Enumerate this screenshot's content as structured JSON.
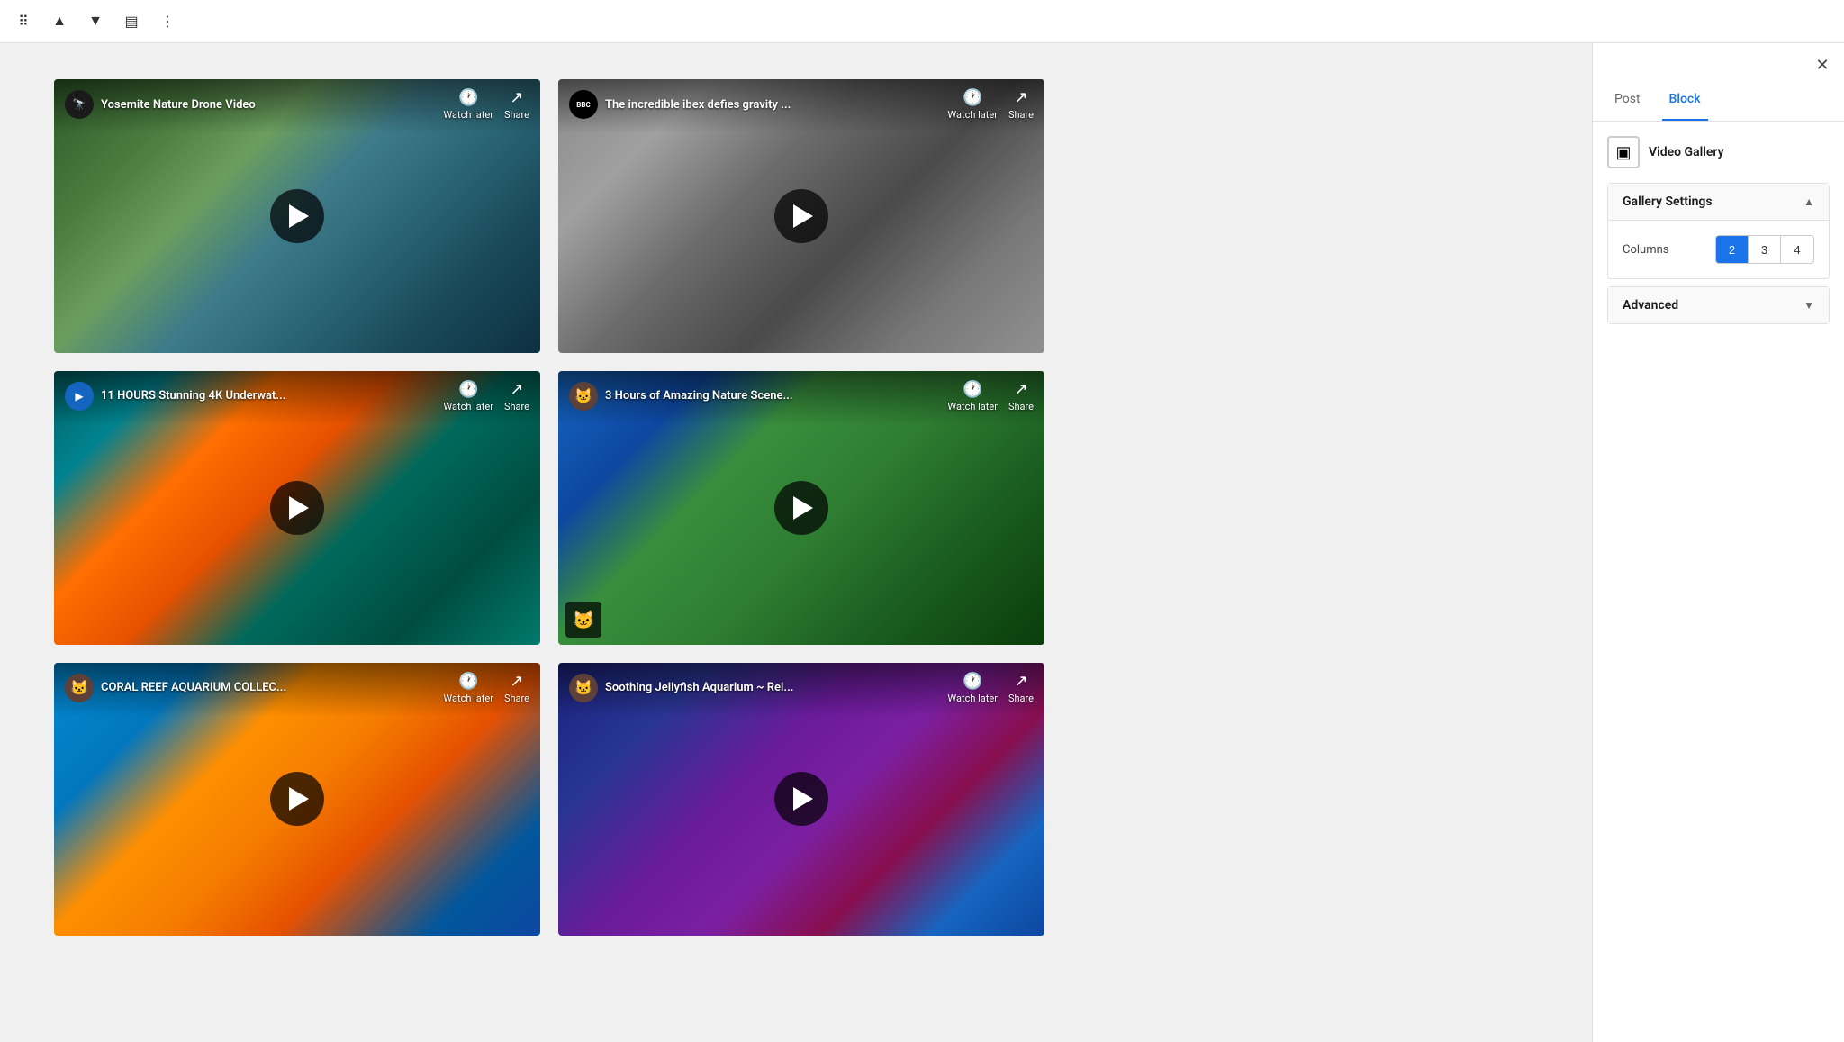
{
  "toolbar": {
    "drag_icon": "⠿",
    "move_up_icon": "▲",
    "move_down_icon": "▼",
    "align_icon": "▤",
    "more_icon": "⋮"
  },
  "sidebar": {
    "close_icon": "✕",
    "tabs": [
      {
        "id": "post",
        "label": "Post",
        "active": false
      },
      {
        "id": "block",
        "label": "Block",
        "active": true
      }
    ],
    "block": {
      "icon": "▣",
      "name": "Video Gallery"
    },
    "gallery_settings": {
      "title": "Gallery Settings",
      "columns_label": "Columns",
      "columns": [
        2,
        3,
        4
      ],
      "active_column": 2
    },
    "advanced": {
      "title": "Advanced"
    }
  },
  "videos": [
    {
      "id": "yosemite",
      "title": "Yosemite Nature Drone Video",
      "channel": "🔭",
      "channel_type": "dark",
      "bg_class": "bg-yosemite",
      "watch_later": "Watch later",
      "share": "Share"
    },
    {
      "id": "ibex",
      "title": "The incredible ibex defies gravity ...",
      "channel": "BBC",
      "channel_type": "bbc",
      "bg_class": "bg-ibex",
      "watch_later": "Watch later",
      "share": "Share"
    },
    {
      "id": "underwater",
      "title": "11 HOURS Stunning 4K Underwat...",
      "channel": "▶",
      "channel_type": "blue",
      "bg_class": "bg-underwater",
      "watch_later": "Watch later",
      "share": "Share"
    },
    {
      "id": "nature",
      "title": "3 Hours of Amazing Nature Scene...",
      "channel": "🐱",
      "channel_type": "cat",
      "bg_class": "bg-nature",
      "watch_later": "Watch later",
      "share": "Share",
      "bottom_logo": true
    },
    {
      "id": "coral",
      "title": "CORAL REEF AQUARIUM COLLEC...",
      "channel": "🐱",
      "channel_type": "cat",
      "bg_class": "bg-coral",
      "watch_later": "Watch later",
      "share": "Share"
    },
    {
      "id": "jellyfish",
      "title": "Soothing Jellyfish Aquarium ~ Rel...",
      "channel": "🐱",
      "channel_type": "cat",
      "bg_class": "bg-jellyfish",
      "watch_later": "Watch later",
      "share": "Share"
    }
  ]
}
